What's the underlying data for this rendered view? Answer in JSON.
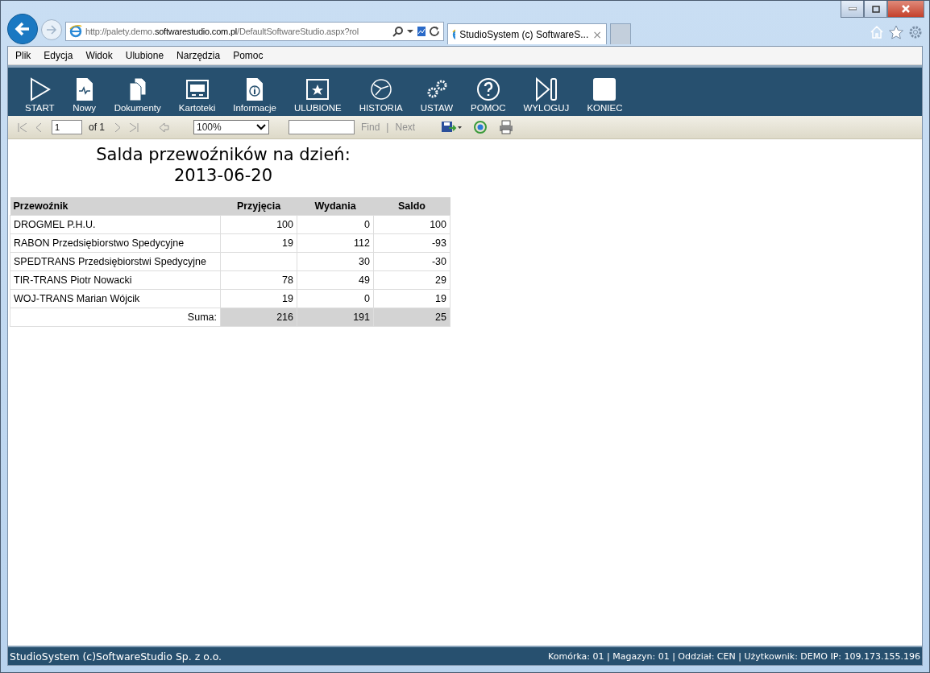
{
  "browser": {
    "address": "http://palety.demo.**softwarestudio.com.pl**/DefaultSoftwareStudio.aspx?rol",
    "tab_title": "StudioSystem (c) SoftwareS...",
    "tab_close": "×"
  },
  "menu": [
    "Plik",
    "Edycja",
    "Widok",
    "Ulubione",
    "Narzędzia",
    "Pomoc"
  ],
  "app_toolbar": [
    {
      "label": "START",
      "kind": "play"
    },
    {
      "label": "Nowy",
      "kind": "pulse-doc"
    },
    {
      "label": "Dokumenty",
      "kind": "docs"
    },
    {
      "label": "Kartoteki",
      "kind": "screen"
    },
    {
      "label": "Informacje",
      "kind": "info"
    },
    {
      "label": "ULUBIONE",
      "kind": "star"
    },
    {
      "label": "HISTORIA",
      "kind": "history"
    },
    {
      "label": "USTAW",
      "kind": "gears"
    },
    {
      "label": "POMOC",
      "kind": "help"
    },
    {
      "label": "WYLOGUJ",
      "kind": "logout"
    },
    {
      "label": "KONIEC",
      "kind": "square"
    }
  ],
  "report_toolbar": {
    "page": "1",
    "of": "of 1",
    "zoom": "100%",
    "find": "Find",
    "separator": "|",
    "next": "Next"
  },
  "report": {
    "title": "Salda przewoźników na dzień:",
    "date": "2013-06-20",
    "columns": [
      "Przewoźnik",
      "Przyjęcia",
      "Wydania",
      "Saldo"
    ],
    "rows": [
      [
        "DROGMEL P.H.U.",
        "100",
        "0",
        "100"
      ],
      [
        "RABON Przedsiębiorstwo Spedycyjne",
        "19",
        "112",
        "-93"
      ],
      [
        "SPEDTRANS Przedsiębiorstwi Spedycyjne",
        "",
        "30",
        "-30"
      ],
      [
        "TIR-TRANS Piotr Nowacki",
        "78",
        "49",
        "29"
      ],
      [
        "WOJ-TRANS Marian Wójcik",
        "19",
        "0",
        "19"
      ]
    ],
    "total": [
      "Suma:",
      "216",
      "191",
      "25"
    ]
  },
  "status_bar": {
    "left": "StudioSystem (c)SoftwareStudio Sp. z o.o.",
    "right": "Komórka: 01 | Magazyn: 01 | Oddział: CEN | Użytkownik: DEMO IP: 109.173.155.196"
  }
}
